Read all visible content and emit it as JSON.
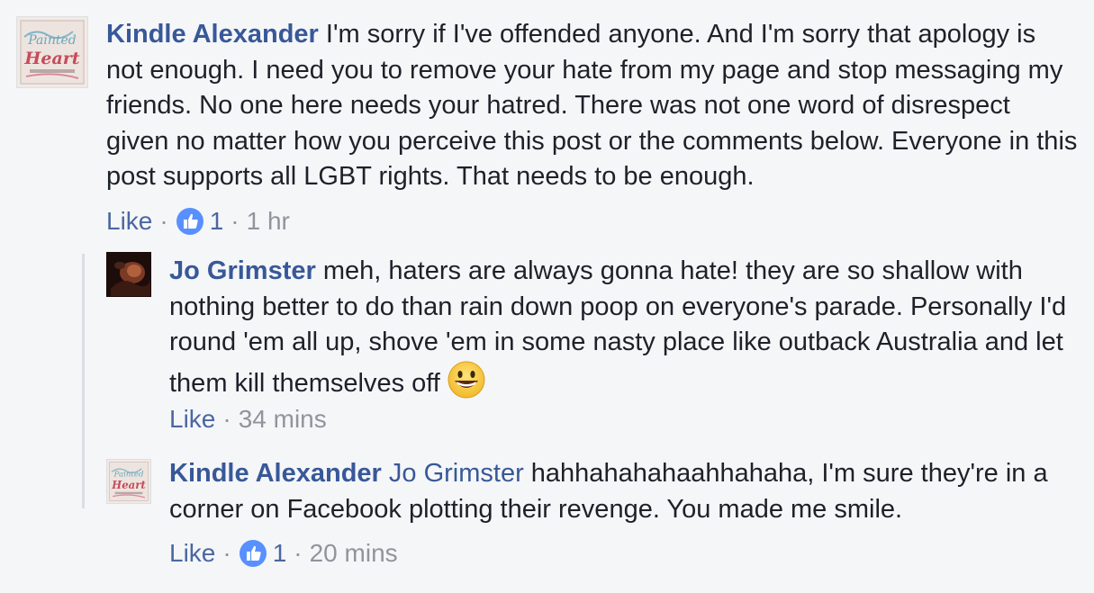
{
  "comments": [
    {
      "author": "Kindle Alexander",
      "text": "I'm sorry if I've offended anyone. And I'm sorry that apology is not enough. I need you to remove your hate from my page and stop messaging my friends. No one here needs your hatred. There was not one word of disrespect given no matter how you perceive this post or the comments below. Everyone in this post supports all LGBT rights. That needs to be enough.",
      "like_label": "Like",
      "reaction_count": "1",
      "timestamp": "1 hr",
      "avatar_icon": "book-cover-avatar"
    }
  ],
  "replies": [
    {
      "author": "Jo Grimster",
      "text": "meh, haters are always gonna hate! they are so shallow with nothing better to do than rain down poop on everyone's parade. Personally I'd round 'em all up, shove 'em in some nasty place like outback Australia and let them kill themselves off",
      "emoji": "grinning-face-emoji",
      "like_label": "Like",
      "timestamp": "34 mins",
      "avatar_icon": "photo-avatar"
    },
    {
      "author": "Kindle Alexander",
      "mention": "Jo Grimster",
      "text": "hahhahahahaahhahaha, I'm sure they're in a corner on Facebook plotting their revenge. You made me smile.",
      "like_label": "Like",
      "reaction_count": "1",
      "timestamp": "20 mins",
      "avatar_icon": "book-cover-avatar"
    }
  ],
  "separator": "·",
  "colors": {
    "author_link": "#385898",
    "like_link": "#4b67a1",
    "meta_gray": "#90949c",
    "background": "#f5f6f8",
    "like_badge_blue": "#5890ff"
  }
}
